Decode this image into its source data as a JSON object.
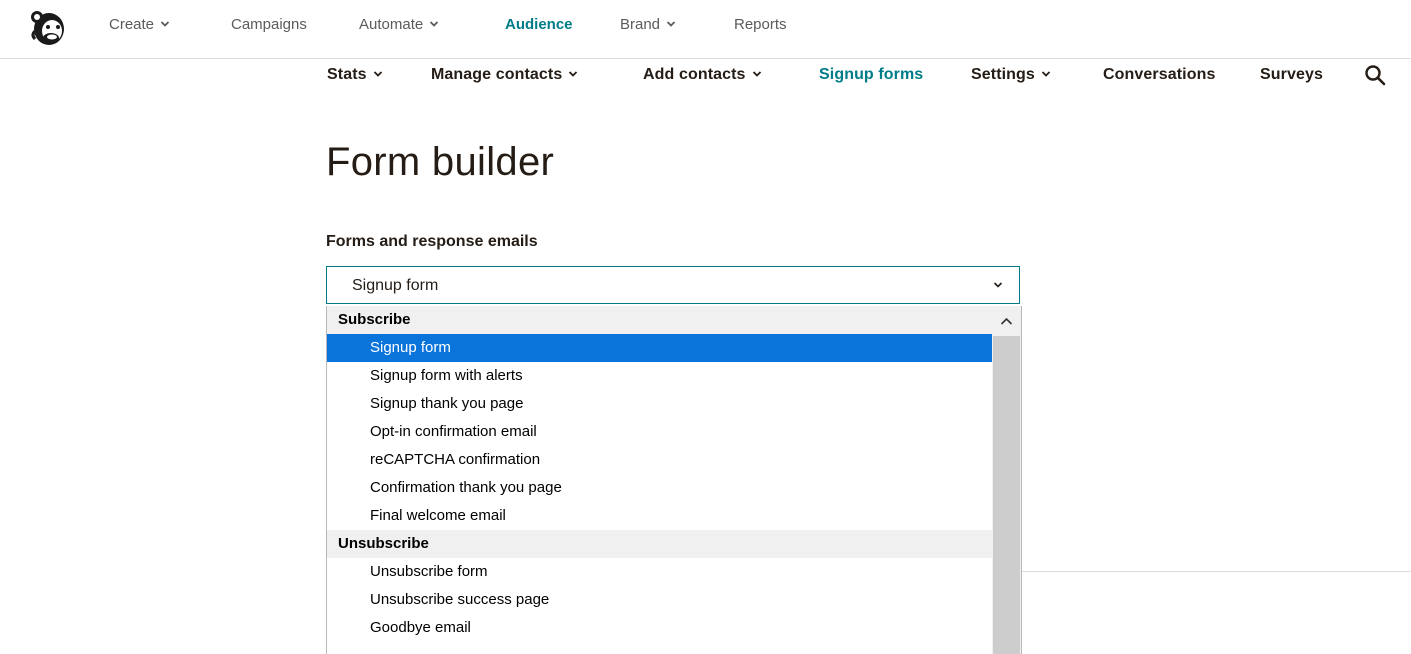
{
  "top_nav": {
    "items": [
      {
        "label": "Create",
        "has_menu": true
      },
      {
        "label": "Campaigns",
        "has_menu": false
      },
      {
        "label": "Automate",
        "has_menu": true
      },
      {
        "label": "Audience",
        "has_menu": false,
        "active": true
      },
      {
        "label": "Brand",
        "has_menu": true
      },
      {
        "label": "Reports",
        "has_menu": false
      }
    ]
  },
  "sub_nav": {
    "items": [
      {
        "label": "Stats",
        "has_menu": true
      },
      {
        "label": "Manage contacts",
        "has_menu": true
      },
      {
        "label": "Add contacts",
        "has_menu": true
      },
      {
        "label": "Signup forms",
        "has_menu": false,
        "active": true
      },
      {
        "label": "Settings",
        "has_menu": true
      },
      {
        "label": "Conversations",
        "has_menu": false
      },
      {
        "label": "Surveys",
        "has_menu": false
      }
    ],
    "search_icon": "search-icon"
  },
  "page": {
    "title": "Form builder",
    "forms_label": "Forms and response emails",
    "select_value": "Signup form"
  },
  "dropdown": {
    "groups": [
      {
        "header": "Subscribe",
        "options": [
          "Signup form",
          "Signup form with alerts",
          "Signup thank you page",
          "Opt-in confirmation email",
          "reCAPTCHA confirmation",
          "Confirmation thank you page",
          "Final welcome email"
        ]
      },
      {
        "header": "Unsubscribe",
        "options": [
          "Unsubscribe form",
          "Unsubscribe success page",
          "Goodbye email"
        ]
      }
    ],
    "selected_option": "Signup form"
  },
  "colors": {
    "accent": "#007c89",
    "selection": "#0a74da",
    "text": "#241c15"
  }
}
